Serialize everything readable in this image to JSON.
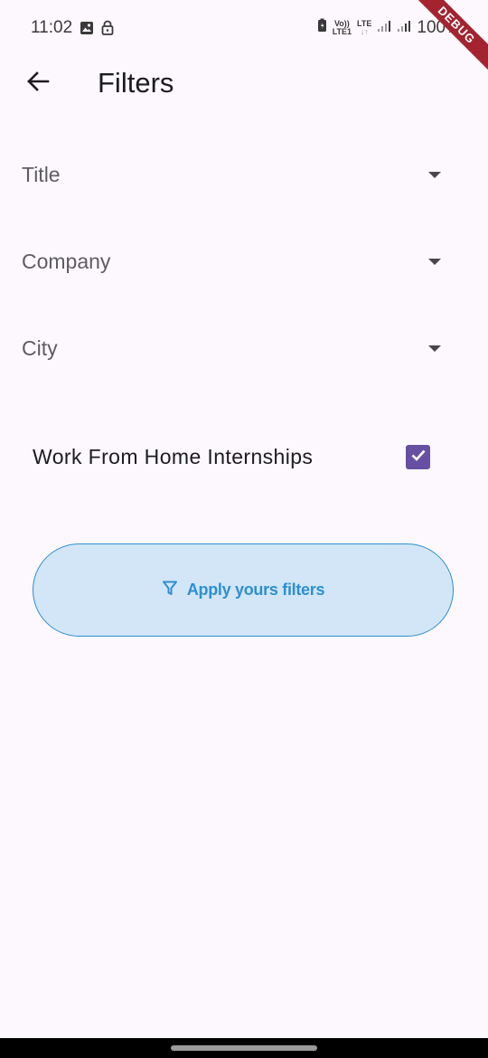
{
  "status_bar": {
    "time": "11:02",
    "volte_label_top": "Vo))",
    "volte_label_bottom": "LTE1",
    "lte_label": "LTE",
    "battery_percent": "100%",
    "icons": [
      "image-icon",
      "lock-icon",
      "battery-saver-icon",
      "signal-icon",
      "signal-icon",
      "battery-icon"
    ]
  },
  "debug_banner": "DEBUG",
  "app_bar": {
    "title": "Filters",
    "back_icon": "arrow-left-icon"
  },
  "filters": {
    "dropdowns": [
      {
        "label": "Title",
        "icon": "caret-down-icon"
      },
      {
        "label": "Company",
        "icon": "caret-down-icon"
      },
      {
        "label": "City",
        "icon": "caret-down-icon"
      }
    ],
    "work_from_home": {
      "label": "Work From Home Internships",
      "checked": true
    }
  },
  "apply_button": {
    "label": "Apply yours filters",
    "icon": "filter-icon"
  },
  "colors": {
    "background": "#fdf8fd",
    "checkbox": "#6750a4",
    "button_fill": "#d2e6f8",
    "button_accent": "#2e8fcf",
    "debug_ribbon": "#a3232f"
  }
}
